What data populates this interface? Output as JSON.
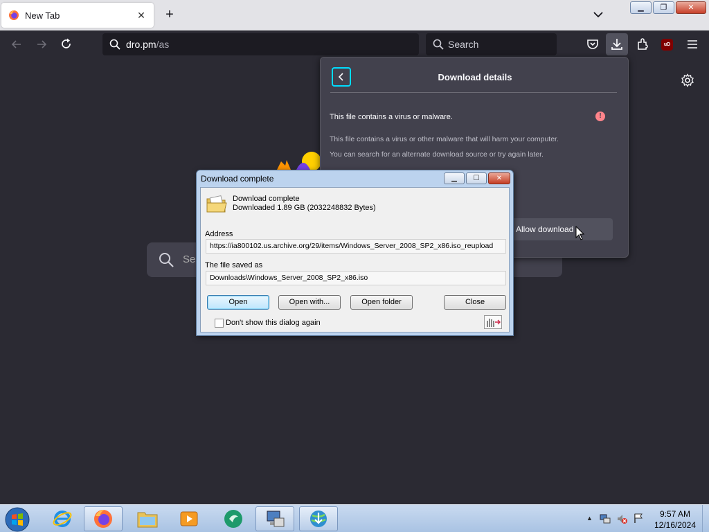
{
  "browser": {
    "tab_title": "New Tab",
    "url_host": "dro.pm",
    "url_path": "/as",
    "search_placeholder": "Search",
    "ublock_badge": "uD"
  },
  "newtab": {
    "search_placeholder_partial": "Se"
  },
  "download_panel": {
    "title": "Download details",
    "warning_title": "This file contains a virus or malware.",
    "warning_line1": "This file contains a virus or other malware that will harm your computer.",
    "warning_line2": "You can search for an alternate download source or try again later.",
    "allow_button": "Allow download",
    "warning_badge": "!"
  },
  "dialog": {
    "title": "Download complete",
    "status_line1": "Download complete",
    "status_line2": "Downloaded 1.89  GB (2032248832 Bytes)",
    "address_label": "Address",
    "address_value": "https://ia800102.us.archive.org/29/items/Windows_Server_2008_SP2_x86.iso_reupload",
    "saved_label": "The file saved as",
    "saved_value": "Downloads\\Windows_Server_2008_SP2_x86.iso",
    "buttons": {
      "open": "Open",
      "open_with": "Open with...",
      "open_folder": "Open folder",
      "close": "Close"
    },
    "checkbox_label": "Don't show this dialog again"
  },
  "taskbar": {
    "items": [
      "internet-explorer",
      "firefox",
      "file-explorer",
      "media-player",
      "green-app",
      "network-app",
      "download-manager"
    ],
    "clock_time": "9:57 AM",
    "clock_date": "12/16/2024"
  },
  "colors": {
    "chrome_dark": "#2b2a33",
    "panel": "#42414d",
    "accent": "#00ddff",
    "warning": "#ff848b"
  }
}
